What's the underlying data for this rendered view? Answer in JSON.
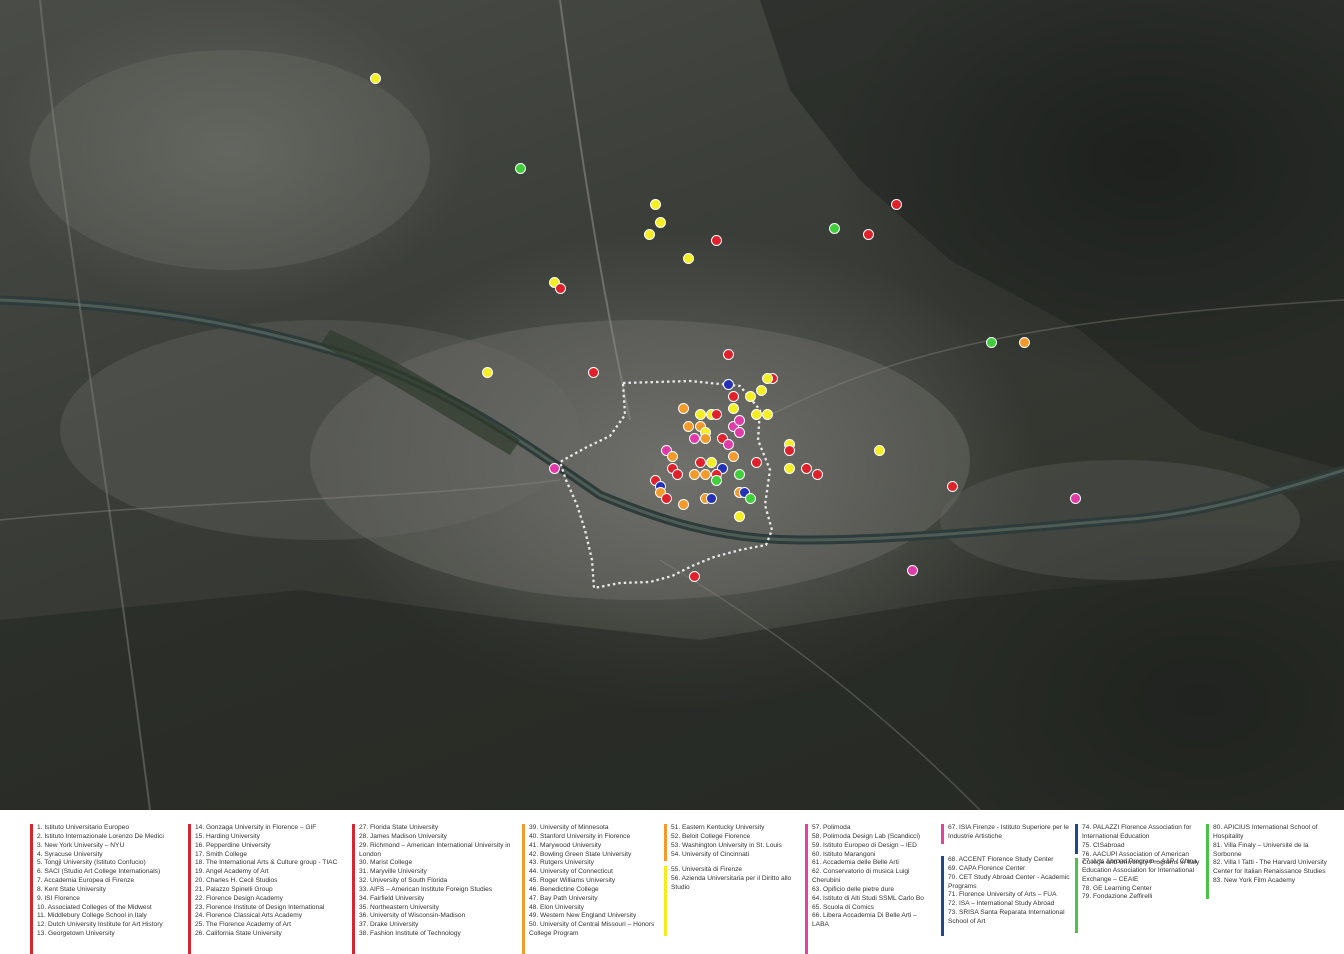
{
  "colors": {
    "red": "#e0202a",
    "orange": "#f39a2a",
    "yellow": "#f4ee22",
    "magenta": "#e03aa8",
    "pink": "#e05098",
    "blue": "#2430b8",
    "green": "#3ecf3a",
    "bar_red": "#d42530",
    "bar_orange": "#f39a2a",
    "bar_yellow": "#f4ec20",
    "bar_magenta": "#e0449a",
    "bar_blue": "#1e4a8c",
    "bar_green": "#4cc24a"
  },
  "map": {
    "markers": [
      {
        "color": "yellow",
        "lon": 11.197,
        "lat": 43.812
      },
      {
        "color": "green",
        "lon": 11.223,
        "lat": 43.797
      },
      {
        "color": "yellow",
        "lon": 11.247,
        "lat": 43.791
      },
      {
        "color": "yellow",
        "lon": 11.248,
        "lat": 43.788
      },
      {
        "color": "yellow",
        "lon": 11.246,
        "lat": 43.786
      },
      {
        "color": "red",
        "lon": 11.258,
        "lat": 43.785
      },
      {
        "color": "yellow",
        "lon": 11.253,
        "lat": 43.782
      },
      {
        "color": "yellow",
        "lon": 11.229,
        "lat": 43.778
      },
      {
        "color": "red",
        "lon": 11.23,
        "lat": 43.777
      },
      {
        "color": "red",
        "lon": 11.29,
        "lat": 43.791
      },
      {
        "color": "green",
        "lon": 11.279,
        "lat": 43.787
      },
      {
        "color": "red",
        "lon": 11.285,
        "lat": 43.786
      },
      {
        "color": "green",
        "lon": 11.307,
        "lat": 43.768
      },
      {
        "color": "orange",
        "lon": 11.313,
        "lat": 43.768
      },
      {
        "color": "red",
        "lon": 11.26,
        "lat": 43.766
      },
      {
        "color": "yellow",
        "lon": 11.217,
        "lat": 43.763
      },
      {
        "color": "red",
        "lon": 11.236,
        "lat": 43.763
      },
      {
        "color": "red",
        "lon": 11.268,
        "lat": 43.762
      },
      {
        "color": "yellow",
        "lon": 11.267,
        "lat": 43.762
      },
      {
        "color": "blue",
        "lon": 11.26,
        "lat": 43.761
      },
      {
        "color": "yellow",
        "lon": 11.264,
        "lat": 43.759
      },
      {
        "color": "yellow",
        "lon": 11.266,
        "lat": 43.76
      },
      {
        "color": "red",
        "lon": 11.261,
        "lat": 43.759
      },
      {
        "color": "orange",
        "lon": 11.252,
        "lat": 43.757
      },
      {
        "color": "yellow",
        "lon": 11.255,
        "lat": 43.756
      },
      {
        "color": "yellow",
        "lon": 11.257,
        "lat": 43.756
      },
      {
        "color": "red",
        "lon": 11.258,
        "lat": 43.756
      },
      {
        "color": "yellow",
        "lon": 11.261,
        "lat": 43.757
      },
      {
        "color": "yellow",
        "lon": 11.265,
        "lat": 43.756
      },
      {
        "color": "yellow",
        "lon": 11.267,
        "lat": 43.756
      },
      {
        "color": "orange",
        "lon": 11.253,
        "lat": 43.754
      },
      {
        "color": "orange",
        "lon": 11.255,
        "lat": 43.754
      },
      {
        "color": "yellow",
        "lon": 11.256,
        "lat": 43.753
      },
      {
        "color": "orange",
        "lon": 11.256,
        "lat": 43.752
      },
      {
        "color": "magenta",
        "lon": 11.261,
        "lat": 43.754
      },
      {
        "color": "magenta",
        "lon": 11.262,
        "lat": 43.755
      },
      {
        "color": "magenta",
        "lon": 11.254,
        "lat": 43.752
      },
      {
        "color": "red",
        "lon": 11.259,
        "lat": 43.752
      },
      {
        "color": "magenta",
        "lon": 11.262,
        "lat": 43.753
      },
      {
        "color": "magenta",
        "lon": 11.26,
        "lat": 43.751
      },
      {
        "color": "yellow",
        "lon": 11.271,
        "lat": 43.751
      },
      {
        "color": "magenta",
        "lon": 11.249,
        "lat": 43.75
      },
      {
        "color": "orange",
        "lon": 11.25,
        "lat": 43.749
      },
      {
        "color": "orange",
        "lon": 11.261,
        "lat": 43.749
      },
      {
        "color": "yellow",
        "lon": 11.257,
        "lat": 43.748
      },
      {
        "color": "red",
        "lon": 11.271,
        "lat": 43.75
      },
      {
        "color": "yellow",
        "lon": 11.271,
        "lat": 43.747
      },
      {
        "color": "blue",
        "lon": 11.259,
        "lat": 43.747
      },
      {
        "color": "red",
        "lon": 11.265,
        "lat": 43.748
      },
      {
        "color": "red",
        "lon": 11.255,
        "lat": 43.748
      },
      {
        "color": "red",
        "lon": 11.25,
        "lat": 43.747
      },
      {
        "color": "red",
        "lon": 11.251,
        "lat": 43.746
      },
      {
        "color": "green",
        "lon": 11.262,
        "lat": 43.746
      },
      {
        "color": "red",
        "lon": 11.274,
        "lat": 43.747
      },
      {
        "color": "red",
        "lon": 11.276,
        "lat": 43.746
      },
      {
        "color": "orange",
        "lon": 11.254,
        "lat": 43.746
      },
      {
        "color": "orange",
        "lon": 11.256,
        "lat": 43.746
      },
      {
        "color": "red",
        "lon": 11.258,
        "lat": 43.746
      },
      {
        "color": "green",
        "lon": 11.258,
        "lat": 43.745
      },
      {
        "color": "yellow",
        "lon": 11.287,
        "lat": 43.75
      },
      {
        "color": "magenta",
        "lon": 11.229,
        "lat": 43.747
      },
      {
        "color": "red",
        "lon": 11.247,
        "lat": 43.745
      },
      {
        "color": "blue",
        "lon": 11.248,
        "lat": 43.744
      },
      {
        "color": "orange",
        "lon": 11.248,
        "lat": 43.743
      },
      {
        "color": "red",
        "lon": 11.249,
        "lat": 43.742
      },
      {
        "color": "orange",
        "lon": 11.256,
        "lat": 43.742
      },
      {
        "color": "blue",
        "lon": 11.257,
        "lat": 43.742
      },
      {
        "color": "orange",
        "lon": 11.252,
        "lat": 43.741
      },
      {
        "color": "orange",
        "lon": 11.262,
        "lat": 43.743
      },
      {
        "color": "blue",
        "lon": 11.263,
        "lat": 43.743
      },
      {
        "color": "green",
        "lon": 11.264,
        "lat": 43.742
      },
      {
        "color": "yellow",
        "lon": 11.262,
        "lat": 43.739
      },
      {
        "color": "red",
        "lon": 11.3,
        "lat": 43.744
      },
      {
        "color": "magenta",
        "lon": 11.322,
        "lat": 43.742
      },
      {
        "color": "magenta",
        "lon": 11.293,
        "lat": 43.73
      },
      {
        "color": "red",
        "lon": 11.254,
        "lat": 43.729
      }
    ]
  },
  "legend": {
    "columns": [
      {
        "bar": "bar_red",
        "items": [
          "1.  Istituto Universitario Europeo",
          "2.  Istituto Internazionale Lorenzo De Medici",
          "3.  New York University – NYU",
          "4.  Syracuse University",
          "5.  Tongji University (Istituto Confucio)",
          "6.  SACI (Studio Art College Internationals)",
          "7.  Accademia Europea di Firenze",
          "8.  Kent State University",
          "9.  ISI Florence",
          "10. Associated Colleges of the Midwest",
          "11. Middlebury College School in Italy",
          "12. Dutch University Institute for Art History",
          "13. Georgetown University"
        ]
      },
      {
        "bar": "bar_red",
        "items": [
          "14. Gonzaga University in Florence – GIF",
          "15. Harding University",
          "16. Pepperdine University",
          "17. Smith College",
          "18. The International Arts & Culture group  - TIAC",
          "19. Angel Academy of Art",
          "20. Charles H. Cecil Studios",
          "21. Palazzo Spinelli Group",
          "22. Florence Design Academy",
          "23. Florence Institute of Design International",
          "24. Florence Classical Arts Academy",
          "25. The Florence Academy of Art",
          "26. California State University"
        ]
      },
      {
        "bar": "bar_red",
        "items": [
          "27. Florida State University",
          "28. James Madison University",
          "29. Richmond – American International University in London",
          "30. Marist College",
          "31. Maryville University",
          "32. University of South Florida",
          "33. AIFS – American Institute Foreign Studies",
          "34. Fairfield University",
          "35. Northeastern University",
          "36. University of Wisconsin-Madison",
          "37. Drake University",
          "38. Fashion Institute of Technology"
        ]
      },
      {
        "bar": "bar_orange",
        "items": [
          "39. University of Minnesota",
          "40. Stanford University in Florence",
          "41. Marywood University",
          "42. Bowling Green State University",
          "43. Rutgers University",
          "44. University of Connecticut",
          "45. Roger Williams University",
          "46. Benedictine College",
          "47. Bay Path University",
          "48. Elon University",
          "49. Western New England University",
          "50. University of Central Missouri – Honors College Program"
        ]
      },
      {
        "bar": "bar_orange",
        "items": [
          "51. Eastern Kentucky University",
          "52. Beloit College Florence",
          "53. Washington University in St. Louis",
          "54. University of Cincinnati"
        ]
      },
      {
        "bar": "bar_yellow",
        "items": [
          "55. Università di Firenze",
          "56. Azienda Universitaria per il Diritto allo Studio"
        ]
      },
      {
        "bar": "bar_magenta",
        "items": [
          "57. Polimoda",
          "58. Polimoda Design Lab (Scandicci)",
          "59. Istituto Europeo di Design – IED",
          "60. Istituto Marangoni",
          "61. Accademia delle Belle Arti",
          "62. Conservatorio di musica Luigi Cherubini",
          "63. Opificio delle pietre dure",
          "64. Istituto di Alti Studi SSML Carlo Bo",
          "65. Scuola di Comics",
          "66. Libera Accademia Di Belle Arti – LABA"
        ]
      },
      {
        "bar": "bar_magenta",
        "items": [
          "67. ISIA Firenze - Istituto Superiore per le Industrie Artistiche"
        ]
      },
      {
        "bar": "bar_blue",
        "items": [
          "68. ACCENT Florence Study Center",
          "69. CAPA Florence Center",
          "70. CET Study Abroad Center - Academic Programs",
          "71. Florence University of Arts – FUA",
          "72. ISA – International Study Abroad",
          "73. SRISA Santa Reparata International School of Art"
        ]
      },
      {
        "bar": "bar_blue",
        "items": [
          "74. PALAZZI Florence Association for International Education",
          "75. CISabroad",
          "76. AACUPI  Association of American College and University Programs in Italy"
        ]
      },
      {
        "bar": "bar_green",
        "items": [
          "77. Arts Abroad Program – AAP / China Education Association for International Exchange – CEAIE",
          "78. GE Learning Center",
          "79. Fondazione Zeffirelli"
        ]
      },
      {
        "bar": "bar_green",
        "items": [
          "80. APICIUS International School of Hospitality",
          "81. Villa Finaly – Université de la Sorbonne",
          "82. Villa I Tatti - The Harvard University Center for Italian Renaissance Studies",
          "83. New York Film Academy"
        ]
      }
    ]
  }
}
